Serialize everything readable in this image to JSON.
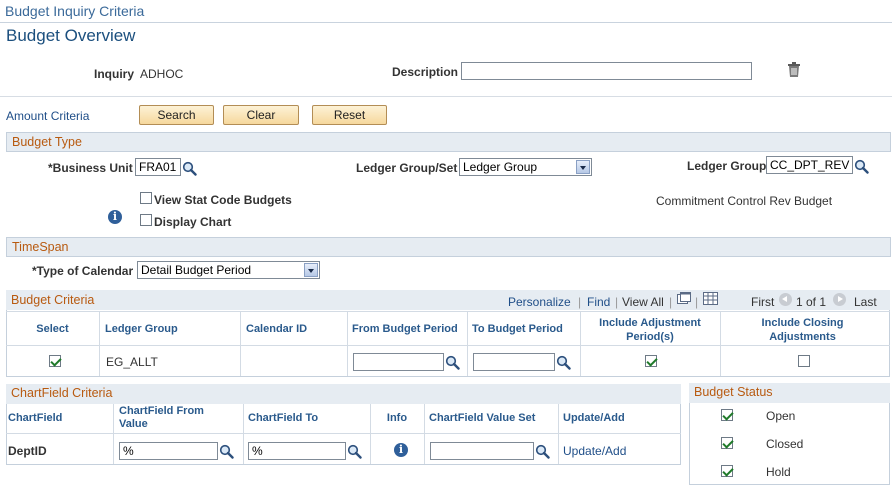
{
  "breadcrumb": "Budget Inquiry Criteria",
  "page_title": "Budget Overview",
  "header": {
    "inquiry_label": "Inquiry",
    "inquiry_value": "ADHOC",
    "description_label": "Description",
    "description_value": ""
  },
  "amount_criteria": {
    "link": "Amount Criteria",
    "search": "Search",
    "clear": "Clear",
    "reset": "Reset"
  },
  "budget_type": {
    "section": "Budget Type",
    "business_unit_label": "*Business Unit",
    "business_unit_value": "FRA01",
    "ledger_group_set_label": "Ledger Group/Set",
    "ledger_group_set_value": "Ledger Group",
    "ledger_group_label": "Ledger Group",
    "ledger_group_value": "CC_DPT_REV",
    "ledger_group_desc": "Commitment Control Rev Budget",
    "view_stat_label": "View Stat Code Budgets",
    "view_stat_checked": false,
    "display_chart_label": "Display Chart",
    "display_chart_checked": false
  },
  "timespan": {
    "section": "TimeSpan",
    "type_label": "*Type of Calendar",
    "type_value": "Detail Budget Period"
  },
  "budget_criteria": {
    "section": "Budget Criteria",
    "personalize": "Personalize",
    "find": "Find",
    "view_all": "View All",
    "first": "First",
    "range": "1 of 1",
    "last": "Last",
    "columns": {
      "select": "Select",
      "ledger_group": "Ledger Group",
      "calendar_id": "Calendar ID",
      "from_period": "From Budget Period",
      "to_period": "To Budget Period",
      "include_adj": "Include Adjustment Period(s)",
      "include_closing": "Include Closing Adjustments"
    },
    "row": {
      "select": true,
      "ledger_group": "EG_ALLT",
      "calendar_id": "",
      "from_period": "",
      "to_period": "",
      "include_adj": true,
      "include_closing": false
    }
  },
  "chartfield_criteria": {
    "section": "ChartField Criteria",
    "columns": {
      "chartfield": "ChartField",
      "from_value": "ChartField From Value",
      "to": "ChartField To",
      "info": "Info",
      "value_set": "ChartField Value Set",
      "update_add": "Update/Add"
    },
    "row": {
      "chartfield": "DeptID",
      "from_value": "%",
      "to": "%",
      "value_set": "",
      "update_add": "Update/Add"
    }
  },
  "budget_status": {
    "section": "Budget Status",
    "items": [
      {
        "label": "Open",
        "checked": true
      },
      {
        "label": "Closed",
        "checked": true
      },
      {
        "label": "Hold",
        "checked": true
      }
    ]
  }
}
